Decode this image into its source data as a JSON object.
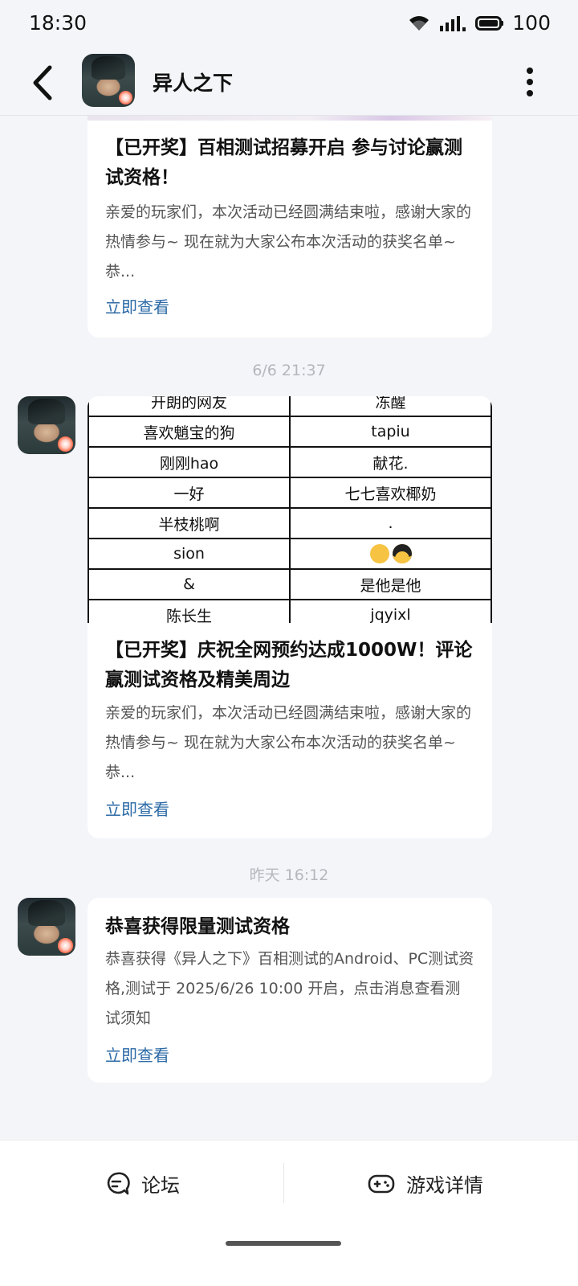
{
  "status": {
    "time": "18:30",
    "battery": "100"
  },
  "header": {
    "title": "异人之下"
  },
  "cards": [
    {
      "title": "【已开奖】百相测试招募开启 参与讨论赢测试资格！",
      "desc": "亲爱的玩家们，本次活动已经圆满结束啦，感谢大家的热情参与~ 现在就为大家公布本次活动的获奖名单~ 恭...",
      "link": "立即查看"
    },
    {
      "timestamp": "6/6  21:37",
      "table": [
        [
          "开朗的网友",
          "冻醒"
        ],
        [
          "喜欢魈宝的狗",
          "tapiu"
        ],
        [
          "刚刚hao",
          "献花."
        ],
        [
          "一好",
          "七七喜欢椰奶"
        ],
        [
          "半枝桃啊",
          "."
        ],
        [
          "sion",
          ""
        ],
        [
          "&",
          "是他是他"
        ],
        [
          "陈长生",
          "jqyixl"
        ]
      ],
      "title": "【已开奖】庆祝全网预约达成1000W！评论赢测试资格及精美周边",
      "desc": "亲爱的玩家们，本次活动已经圆满结束啦，感谢大家的热情参与~ 现在就为大家公布本次活动的获奖名单~ 恭...",
      "link": "立即查看"
    },
    {
      "timestamp": "昨天  16:12",
      "title": "恭喜获得限量测试资格",
      "desc": "恭喜获得《异人之下》百相测试的Android、PC测试资格,测试于 2025/6/26 10:00 开启，点击消息查看测试须知",
      "link": "立即查看"
    }
  ],
  "bottom": {
    "forum": "论坛",
    "game_detail": "游戏详情"
  }
}
